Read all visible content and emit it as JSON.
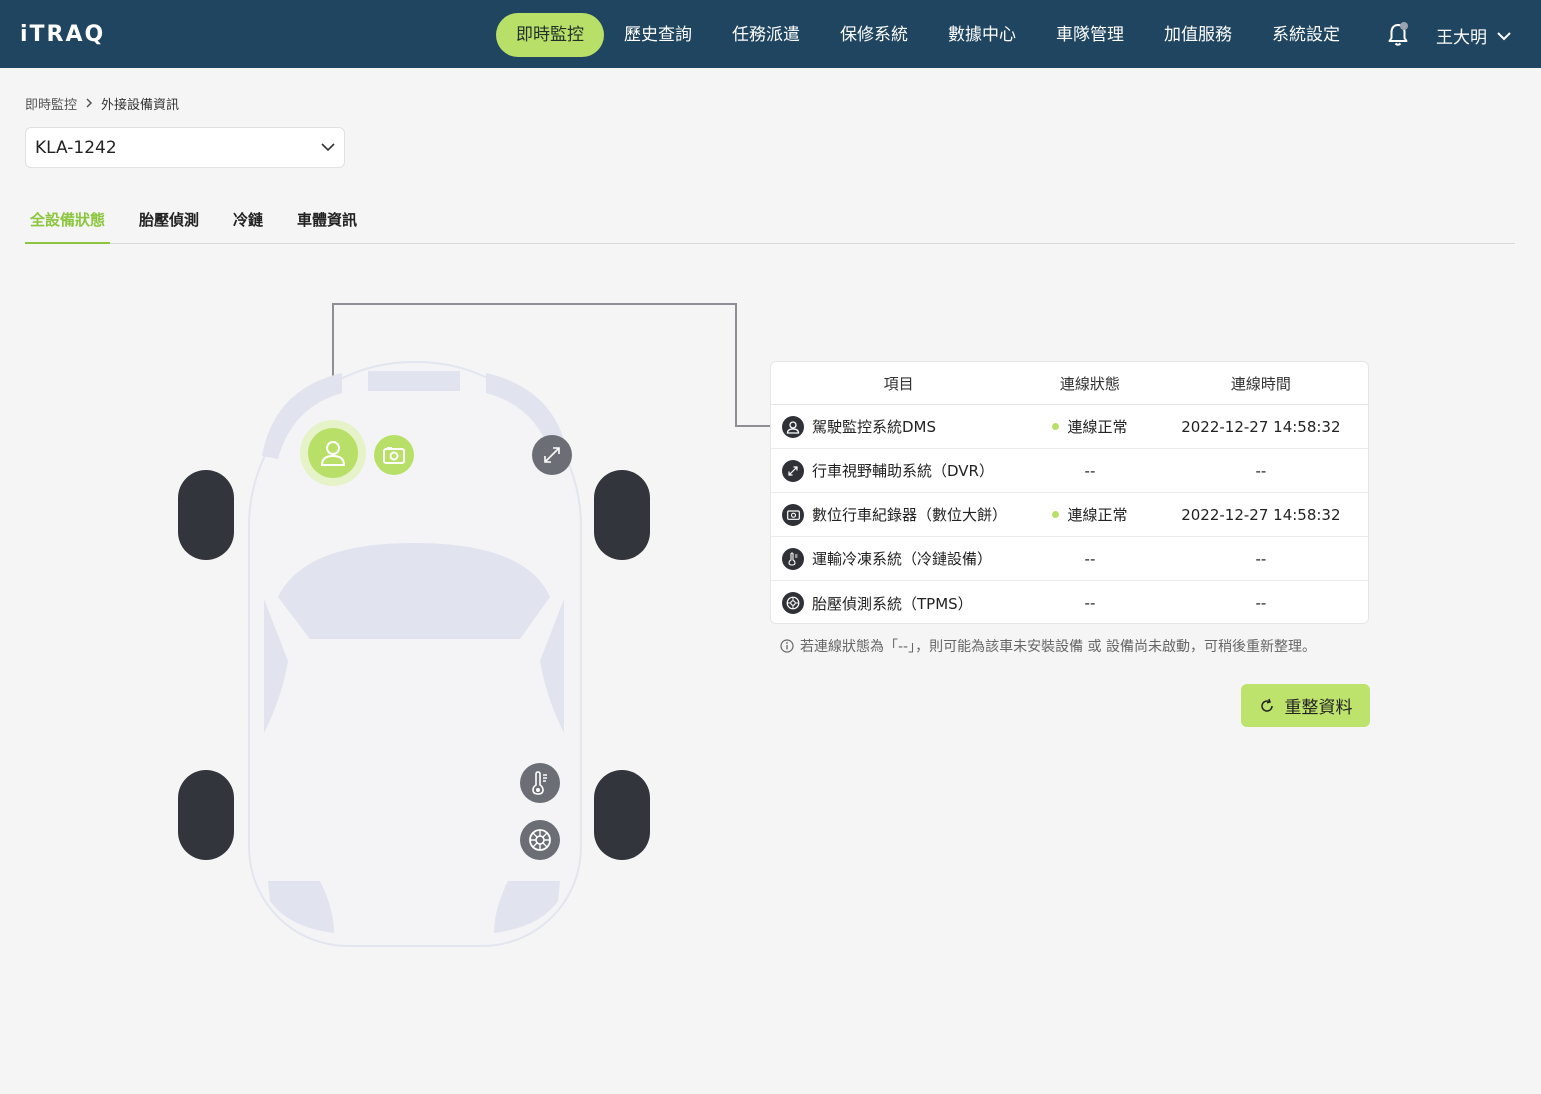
{
  "app": {
    "logo": "iTRAQ"
  },
  "nav": {
    "items": [
      {
        "label": "即時監控",
        "active": true
      },
      {
        "label": "歷史查詢"
      },
      {
        "label": "任務派遣"
      },
      {
        "label": "保修系統"
      },
      {
        "label": "數據中心"
      },
      {
        "label": "車隊管理"
      },
      {
        "label": "加值服務"
      },
      {
        "label": "系統設定"
      }
    ]
  },
  "user": {
    "name": "王大明"
  },
  "breadcrumb": {
    "parent": "即時監控",
    "current": "外接設備資訊"
  },
  "vehicle_select": {
    "value": "KLA-1242"
  },
  "tabs": [
    {
      "label": "全設備狀態",
      "active": true
    },
    {
      "label": "胎壓偵測"
    },
    {
      "label": "冷鏈"
    },
    {
      "label": "車體資訊"
    }
  ],
  "table": {
    "headers": {
      "item": "項目",
      "status": "連線狀態",
      "time": "連線時間"
    },
    "rows": [
      {
        "icon": "driver-icon",
        "name": "駕駛監控系統DMS",
        "status": "連線正常",
        "time": "2022-12-27 14:58:32",
        "connected": true
      },
      {
        "icon": "expand-icon",
        "name": "行車視野輔助系統（DVR）",
        "status": "--",
        "time": "--",
        "connected": false
      },
      {
        "icon": "camera-icon",
        "name": "數位行車紀錄器（數位大餅）",
        "status": "連線正常",
        "time": "2022-12-27 14:58:32",
        "connected": true
      },
      {
        "icon": "thermometer-icon",
        "name": "運輸冷凍系統（冷鏈設備）",
        "status": "--",
        "time": "--",
        "connected": false
      },
      {
        "icon": "tire-icon",
        "name": "胎壓偵測系統（TPMS）",
        "status": "--",
        "time": "--",
        "connected": false
      }
    ]
  },
  "note": "若連線狀態為「--」，則可能為該車未安裝設備 或 設備尚未啟動，可稍後重新整理。",
  "refresh_button": {
    "label": "重整資料"
  },
  "colors": {
    "header_bg": "#1f4560",
    "accent": "#b8e068",
    "tab_active": "#8cc63f",
    "icon_dark": "#2f3137",
    "icon_gray": "#6b6e74"
  }
}
